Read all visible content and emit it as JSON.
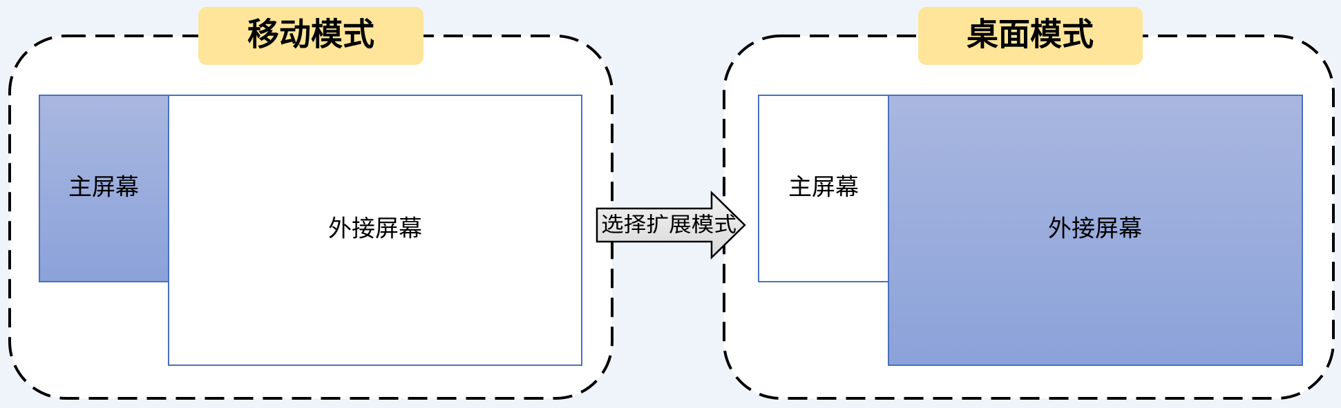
{
  "left_panel": {
    "title": "移动模式",
    "main_screen_label": "主屏幕",
    "external_screen_label": "外接屏幕"
  },
  "right_panel": {
    "title": "桌面模式",
    "main_screen_label": "主屏幕",
    "external_screen_label": "外接屏幕"
  },
  "transition_arrow": {
    "label": "选择扩展模式"
  },
  "colors": {
    "background": "#eff4fb",
    "title_badge": "#ffe599",
    "screen_gradient_top": "#a9b7e0",
    "screen_gradient_bottom": "#8ba2d9",
    "screen_border": "#4a6fc1",
    "arrow_fill_top": "#f2f2f2",
    "arrow_fill_bottom": "#d9d9d9"
  }
}
